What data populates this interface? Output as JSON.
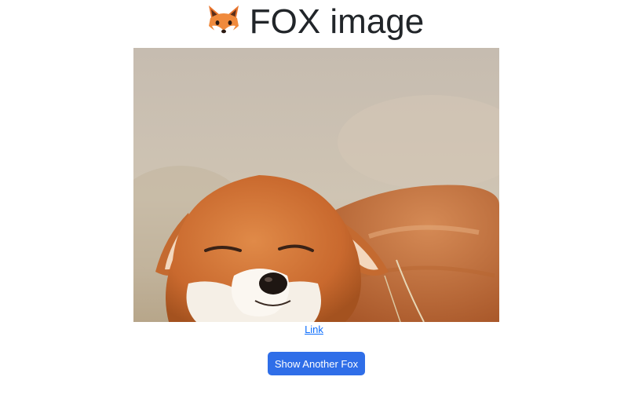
{
  "title": {
    "icon": "fox-face-emoji",
    "text": "FOX image"
  },
  "image": {
    "subject": "fox-photo",
    "alt": "smiling red fox with eyes closed"
  },
  "link": {
    "label": "Link"
  },
  "button": {
    "label": "Show Another Fox"
  },
  "colors": {
    "link": "#0d6efd",
    "button_bg": "#2f6ee8",
    "button_text": "#ffffff",
    "title_text": "#212529"
  }
}
